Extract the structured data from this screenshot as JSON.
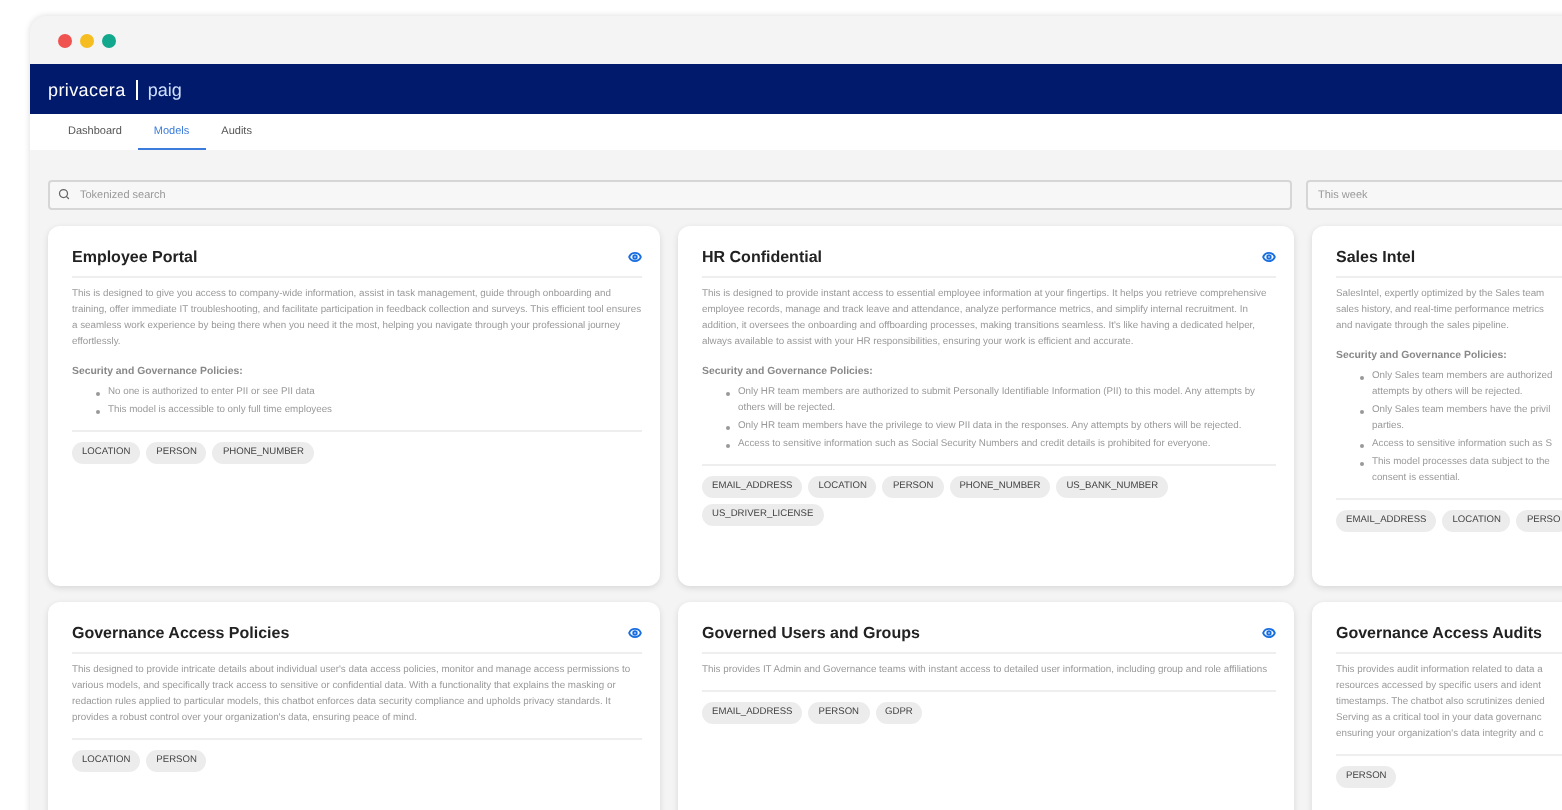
{
  "header": {
    "brand": "privacera",
    "product": "paig"
  },
  "tabs": [
    {
      "label": "Dashboard",
      "selected": false
    },
    {
      "label": "Models",
      "selected": true
    },
    {
      "label": "Audits",
      "selected": false
    }
  ],
  "search": {
    "placeholder": "Tokenized search"
  },
  "date_filter": {
    "placeholder": "This week"
  },
  "cards": [
    {
      "title": "Employee Portal",
      "visibility_icon": true,
      "description": "This is designed to give you access to company-wide information, assist in task management, guide through onboarding and training, offer immediate IT troubleshooting, and facilitate participation in feedback collection and surveys. This efficient tool ensures a seamless work experience by being there when you need it the most, helping you navigate through your professional journey effortlessly.",
      "policies_heading": "Security and Governance Policies:",
      "policies": [
        "No one is authorized to enter PII or see PII data",
        "This model is accessible to only full time employees"
      ],
      "tags": [
        "LOCATION",
        "PERSON",
        "PHONE_NUMBER"
      ]
    },
    {
      "title": "HR Confidential",
      "visibility_icon": true,
      "description": "This is designed to provide instant access to essential employee information at your fingertips. It helps you retrieve comprehensive employee records, manage and track leave and attendance, analyze performance metrics, and simplify internal recruitment. In addition, it oversees the onboarding and offboarding processes, making transitions seamless. It's like having a dedicated helper, always available to assist with your HR responsibilities, ensuring your work is efficient and accurate.",
      "policies_heading": "Security and Governance Policies:",
      "policies": [
        "Only HR team members are authorized to submit Personally Identifiable Information (PII) to this model. Any attempts by others will be rejected.",
        "Only HR team members have the privilege to view PII data in the responses. Any attempts by others will be rejected.",
        "Access to sensitive information such as Social Security Numbers and credit details is prohibited for everyone."
      ],
      "tags": [
        "EMAIL_ADDRESS",
        "LOCATION",
        "PERSON",
        "PHONE_NUMBER",
        "US_BANK_NUMBER",
        "US_DRIVER_LICENSE"
      ]
    },
    {
      "title": "Sales Intel",
      "description": [
        "SalesIntel, expertly optimized by the Sales team",
        "sales history, and real-time performance metrics",
        "and navigate through the sales pipeline."
      ],
      "policies_heading": "Security and Governance Policies:",
      "policies": [
        [
          "Only Sales team members are authorized",
          "attempts by others will be rejected."
        ],
        [
          "Only Sales team members have the privil",
          "parties."
        ],
        [
          "Access to sensitive information such as S"
        ],
        [
          "This model processes data subject to the",
          "consent is essential."
        ]
      ],
      "tags": [
        "EMAIL_ADDRESS",
        "LOCATION",
        "PERSO"
      ]
    },
    {
      "title": "Governance Access Policies",
      "visibility_icon": true,
      "description": "This designed to provide intricate details about individual user's data access policies, monitor and manage access permissions to various models, and specifically track access to sensitive or confidential data. With a functionality that explains the masking or redaction rules applied to particular models, this chatbot enforces data security compliance and upholds privacy standards. It provides a robust control over your organization's data, ensuring peace of mind.",
      "tags": [
        "LOCATION",
        "PERSON"
      ]
    },
    {
      "title": "Governed Users and Groups",
      "visibility_icon": true,
      "description": "This provides IT Admin and Governance teams with instant access to detailed user information, including group and role affiliations",
      "tags": [
        "EMAIL_ADDRESS",
        "PERSON",
        "GDPR"
      ]
    },
    {
      "title": "Governance Access Audits",
      "description": [
        "This provides audit information related to data a",
        "resources accessed by specific users and ident",
        "timestamps. The chatbot also scrutinizes denied",
        "Serving as a critical tool in your data governanc",
        "ensuring your organization's data integrity and c"
      ],
      "tags": [
        "PERSON"
      ]
    }
  ]
}
